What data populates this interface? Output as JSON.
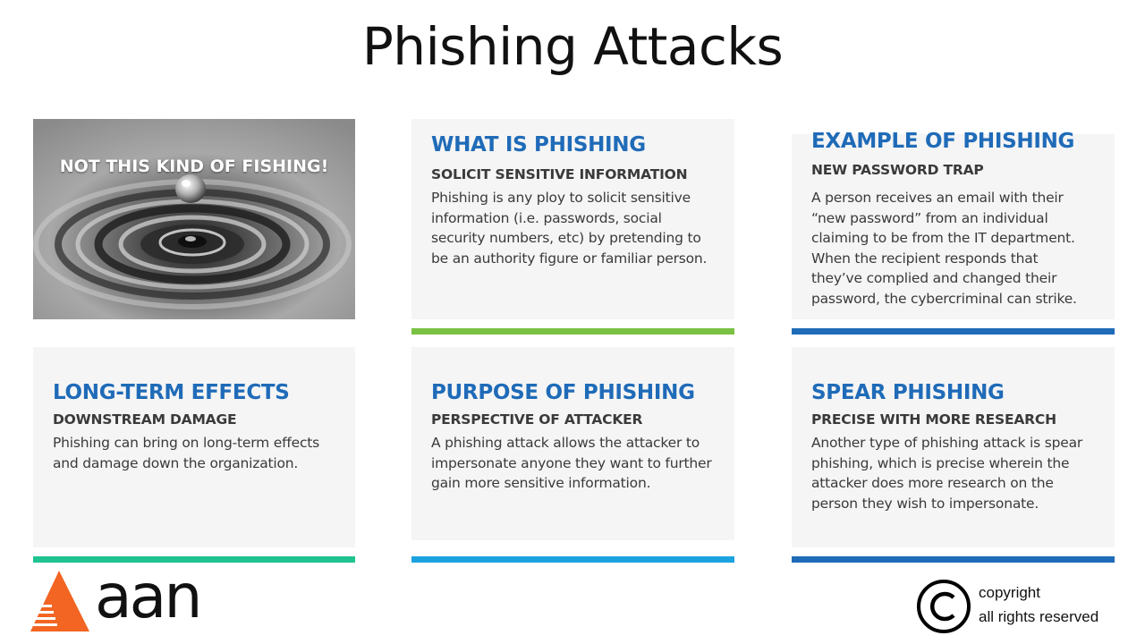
{
  "slide": {
    "title": "Phishing Attacks"
  },
  "photo": {
    "caption": "NOT THIS KIND OF FISHING!",
    "description_icon": "water-drop-ripple-image"
  },
  "cards": {
    "what": {
      "title": "WHAT IS PHISHING",
      "subtitle": "SOLICIT SENSITIVE INFORMATION",
      "body_lines": [
        "Phishing is any ploy to solicit sensitive",
        "information (i.e. passwords, social",
        "security numbers, etc) by pretending to",
        "be an authority figure or familiar person."
      ],
      "accent": "#7ac143"
    },
    "example": {
      "title": "EXAMPLE OF PHISHING",
      "subtitle": "NEW PASSWORD TRAP",
      "body_lines": [
        "A person receives an email with their",
        "“new password” from an individual",
        "claiming to be from the IT department.",
        "When the recipient responds that",
        "they’ve complied and changed their",
        "password, the cybercriminal can strike."
      ],
      "accent": "#1f6bb8"
    },
    "longterm": {
      "title": "LONG-TERM EFFECTS",
      "subtitle": "DOWNSTREAM DAMAGE",
      "body_lines": [
        "Phishing can bring on long-term effects",
        "and damage down the organization."
      ],
      "accent": "#1ec38f"
    },
    "purpose": {
      "title": "PURPOSE OF PHISHING",
      "subtitle": "PERSPECTIVE OF ATTACKER",
      "body_lines": [
        "A phishing attack allows the attacker to",
        "impersonate anyone they want to further",
        "gain more sensitive information."
      ],
      "accent": "#1ba3e0"
    },
    "spear": {
      "title": "SPEAR PHISHING",
      "subtitle": "PRECISE WITH MORE RESEARCH",
      "body_lines": [
        "Another type of phishing attack is spear",
        "phishing, which is precise wherein the",
        "attacker does more research on the",
        "person they wish to impersonate."
      ],
      "accent": "#1f6bb8"
    }
  },
  "colors": {
    "card_title": "#1f6bb8",
    "logo_orange": "#f26522"
  },
  "footer": {
    "logo_text": "aan",
    "copyright_line1": "copyright",
    "copyright_line2": "all rights reserved"
  }
}
